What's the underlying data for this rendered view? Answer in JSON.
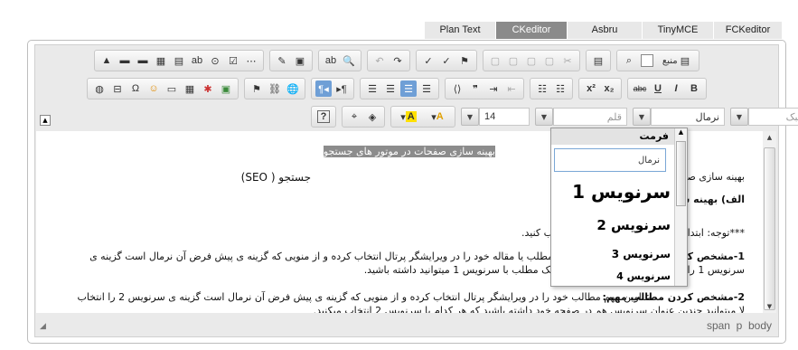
{
  "tabs": [
    "Plan Text",
    "CKeditor",
    "Asbru",
    "TinyMCE",
    "FCKeditor"
  ],
  "active_tab": "CKeditor",
  "toolbar1": {
    "source_label": "منبع"
  },
  "toolbar2": {
    "superscript": "x²",
    "subscript": "x₂",
    "bold": "B",
    "italic": "I",
    "underline": "U",
    "strike": "abc"
  },
  "toolbar3": {
    "style_placeholder": "سبک",
    "format_value": "نرمال",
    "font_placeholder": "قلم",
    "size_value": "14",
    "text_color": "A",
    "bg_color": "A",
    "help": "?"
  },
  "editor": {
    "lines": [
      "بهینه سازی صفحات در موتور های جستجو",
      "بهینه سازی صفحات",
      "جستجو ( SEO)",
      "الف) بهینه ساز",
      "***توجه: ابتدا و",
      "ب کنید.",
      "1-مشخص کردن",
      "مطلب یا مقاله خود را  در ویرایشگر پرتال انتخاب کرده و از منویی که گزینه ی پیش فرض آن نرمال است گزینه ی",
      "سرنویس 1 را ا",
      "یک مطلب با سرنویس 1 میتوانید داشته باشید.",
      "2-مشخص کردن مطالب مهم:",
      "عناوین مهم مطالب خود را  در ویرایشگر پرتال انتخاب کرده و از منویی که گزینه ی پیش فرض آن نرمال است گزینه ی سرنویس 2 را انتخاب",
      "لا میتوانید چندین عنوان سرنویس هم در صفحه خود داشته باشید که هر کدام با سرنویس 2 انتخاب میکنید."
    ]
  },
  "format_panel": {
    "title": "فرمت",
    "options": [
      "نرمال",
      "سرنویس 1",
      "سرنویس 2",
      "سرنویس 3",
      "سرنویس 4"
    ]
  },
  "status_path": "span  p  body"
}
